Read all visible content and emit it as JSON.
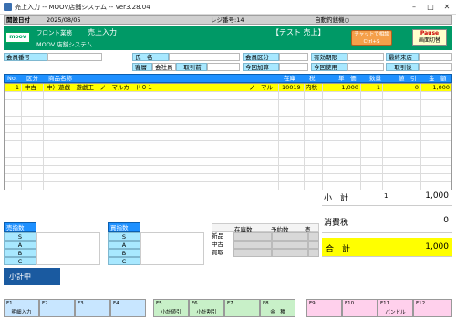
{
  "window": {
    "title": "売上入力 -- MOOV店舗システム -- Ver3.28.04"
  },
  "infobar": {
    "open_date_label": "開設日付",
    "date": "2025/08/05",
    "register_label": "レジ番号:14",
    "auto_receipt_label": "自動釣銭機○"
  },
  "header": {
    "logo": "moov",
    "dept": "フロント業務",
    "screen_title": "売上入力",
    "system_name": "MOOV 店舗システム",
    "mode": "【テスト 売上】",
    "chat_button": "チャットで相談",
    "chat_shortcut": "Ctrl+S",
    "pause_label": "Pause",
    "pause_sub": "画面切替"
  },
  "customer": {
    "member_no_label": "会員番号",
    "name_label": "氏　名",
    "member_class_label": "会員区分",
    "expiry_label": "有効期限",
    "last_visit_label": "最終来店",
    "customer_label": "客層",
    "customer_value": "会社員（男",
    "register_btn": "取引前",
    "points_add_label": "今回加算",
    "points_use_label": "今回使用",
    "after_trade_label": "取引後"
  },
  "grid": {
    "headers": [
      "No.",
      "区分",
      "商品名称",
      "在庫",
      "税",
      "単　価",
      "数量",
      "値　引",
      "金　額"
    ],
    "rows": [
      {
        "no": "1",
        "kind": "中古",
        "name": "中）遊戯　遊戯王　ノーマルカード０１",
        "type": "ノーマル",
        "stock": "10019",
        "tax": "内税",
        "price": "1,000",
        "qty": "1",
        "discount": "0",
        "amount": "1,000"
      }
    ]
  },
  "totals": {
    "subtotal_label": "小　計",
    "subtotal_qty": "1",
    "subtotal_value": "1,000",
    "tax_label": "消費税",
    "tax_value": "0",
    "total_label": "合　計",
    "total_value": "1,000"
  },
  "sales_panel": {
    "title": "売指数",
    "rows": [
      "S",
      "A",
      "B",
      "C"
    ]
  },
  "buy_panel": {
    "title": "買指数",
    "rows": [
      "S",
      "A",
      "B",
      "C"
    ]
  },
  "stock_panel": {
    "headers": [
      "在庫数",
      "予約数",
      "売(販"
    ],
    "rows": [
      "新品",
      "中古",
      "買取"
    ]
  },
  "status": {
    "subtotal_mode": "小計中"
  },
  "fkeys": [
    {
      "key": "F1",
      "label": "明細入力"
    },
    {
      "key": "F2",
      "label": ""
    },
    {
      "key": "F3",
      "label": ""
    },
    {
      "key": "F4",
      "label": ""
    },
    {
      "key": "F5",
      "label": "小計値引"
    },
    {
      "key": "F6",
      "label": "小計割引"
    },
    {
      "key": "F7",
      "label": ""
    },
    {
      "key": "F8",
      "label": "金　種"
    },
    {
      "key": "F9",
      "label": ""
    },
    {
      "key": "F10",
      "label": ""
    },
    {
      "key": "F11",
      "label": "バンドル"
    },
    {
      "key": "F12",
      "label": ""
    }
  ],
  "colors": {
    "header_green": "#009966",
    "grid_blue": "#1e90ff",
    "label_cyan": "#a8e8ff",
    "total_yellow": "#ffff00",
    "fkey_blue": "#c8e6ff",
    "fkey_green": "#c8f0c8",
    "fkey_pink": "#ffd0ec"
  }
}
